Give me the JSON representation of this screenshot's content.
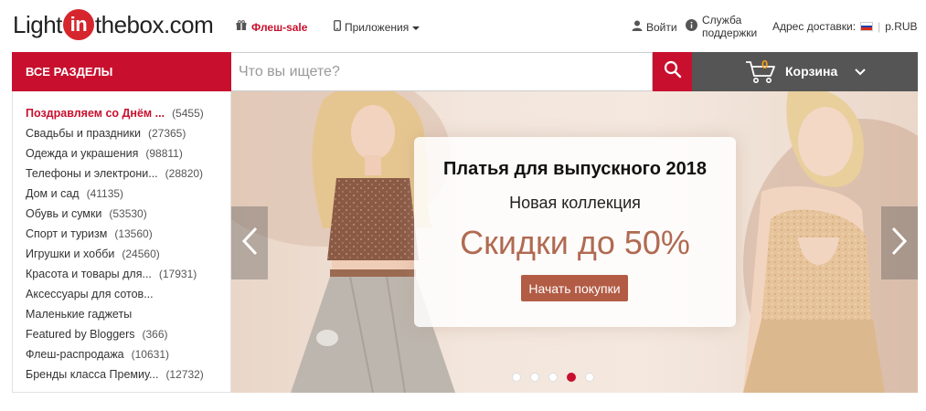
{
  "header": {
    "logo": {
      "light": "Light",
      "in": "in",
      "rest": "thebox.com"
    },
    "flash_sale": "Флеш-sale",
    "apps": "Приложения",
    "login": "Войти",
    "support_line1": "Служба",
    "support_line2": "поддержки",
    "delivery_label": "Адрес доставки:",
    "currency": "р.RUB",
    "colors": {
      "brand_red": "#c8102e",
      "cart_bg": "#555555",
      "cart_count": "#f29d20"
    }
  },
  "search": {
    "all_sections": "ВСЕ РАЗДЕЛЫ",
    "placeholder": "Что вы ищете?",
    "icon": "search-icon"
  },
  "cart": {
    "count": "0",
    "label": "Корзина",
    "icon": "cart-icon"
  },
  "sidebar": {
    "items": [
      {
        "name": "Поздравляем со Днём ...",
        "count": "(5455)",
        "active": true
      },
      {
        "name": "Свадьбы и праздники",
        "count": "(27365)"
      },
      {
        "name": "Одежда и украшения",
        "count": "(98811)"
      },
      {
        "name": "Телефоны и электрони...",
        "count": "(28820)"
      },
      {
        "name": "Дом и сад",
        "count": "(41135)"
      },
      {
        "name": "Обувь и сумки",
        "count": "(53530)"
      },
      {
        "name": "Спорт и туризм",
        "count": "(13560)"
      },
      {
        "name": "Игрушки и хобби",
        "count": "(24560)"
      },
      {
        "name": "Красота и товары для...",
        "count": "(17931)"
      },
      {
        "name": "Аксессуары для сотов...",
        "count": ""
      },
      {
        "name": "Маленькие гаджеты",
        "count": ""
      },
      {
        "name": "Featured by Bloggers",
        "count": "(366)"
      },
      {
        "name": "Флеш-распродажа",
        "count": "(10631)"
      },
      {
        "name": "Бренды класса Премиу...",
        "count": "(12732)"
      }
    ]
  },
  "banner": {
    "headline": "Платья для выпускного 2018",
    "subline": "Новая коллекция",
    "sale": "Скидки до 50%",
    "cta": "Начать покупки",
    "slides_total": 5,
    "active_slide": 4
  }
}
